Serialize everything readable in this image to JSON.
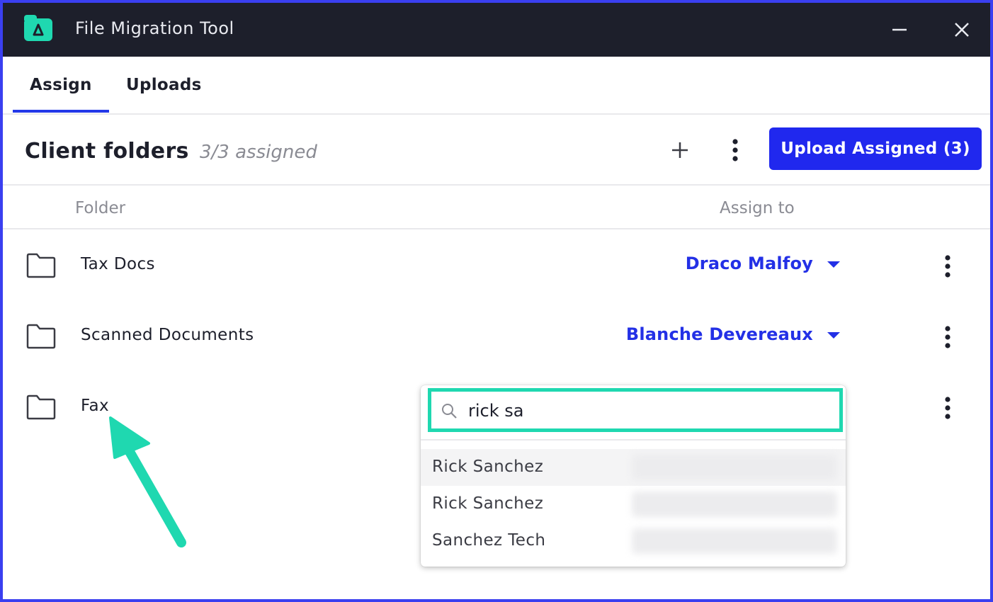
{
  "app": {
    "title": "File Migration Tool"
  },
  "tabs": [
    {
      "label": "Assign",
      "active": true
    },
    {
      "label": "Uploads",
      "active": false
    }
  ],
  "header": {
    "title": "Client folders",
    "assigned_count": "3/3 assigned",
    "upload_button": "Upload Assigned (3)"
  },
  "columns": {
    "folder": "Folder",
    "assign_to": "Assign to"
  },
  "rows": [
    {
      "folder": "Tax Docs",
      "assignee": "Draco Malfoy"
    },
    {
      "folder": "Scanned Documents",
      "assignee": "Blanche Devereaux"
    },
    {
      "folder": "Fax",
      "assignee": ""
    }
  ],
  "dropdown": {
    "search_value": "rick sa",
    "options": [
      {
        "name": "Rick Sanchez"
      },
      {
        "name": "Rick Sanchez"
      },
      {
        "name": "Sanchez Tech"
      }
    ]
  },
  "colors": {
    "accent": "#2028ee",
    "highlight": "#1fd8b0",
    "titlebar": "#1d1f2b",
    "frame": "#3a3ff0"
  }
}
